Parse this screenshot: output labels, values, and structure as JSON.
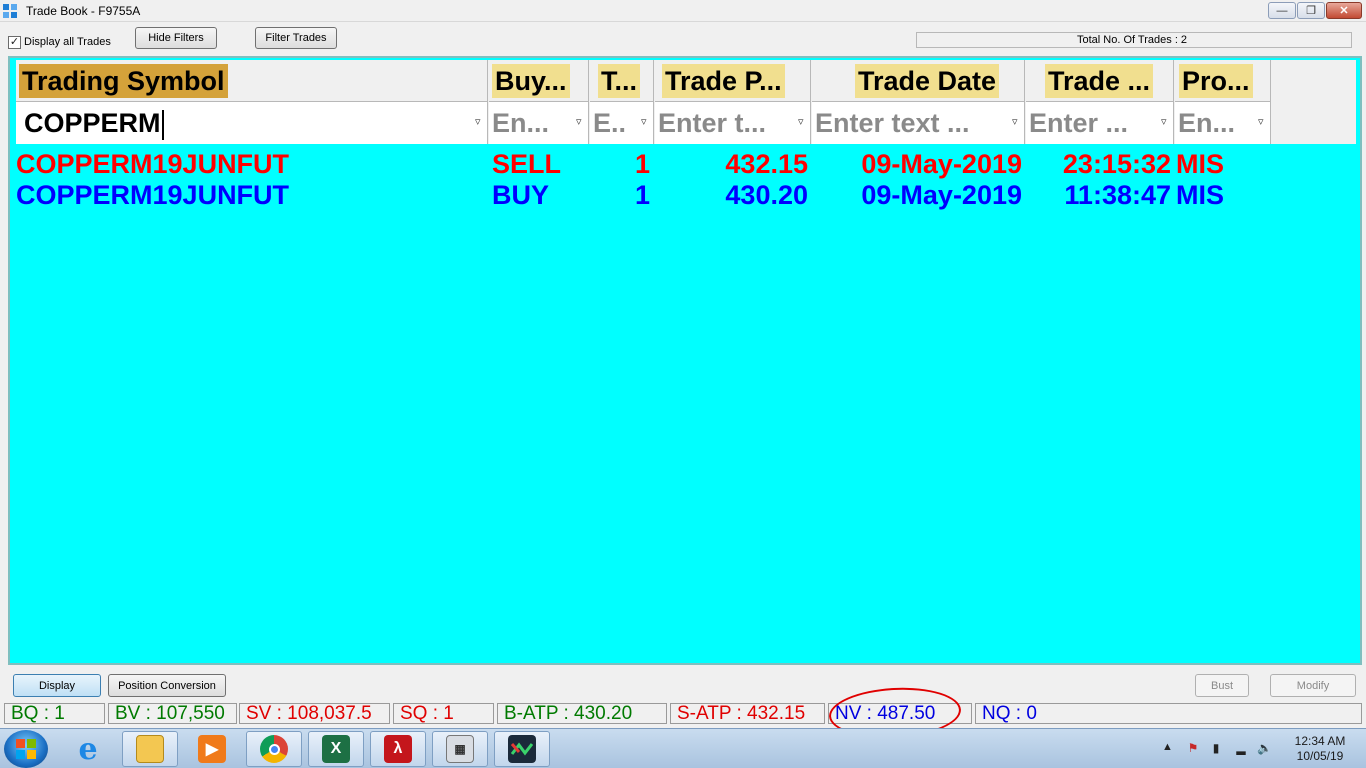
{
  "window": {
    "title": "Trade Book - F9755A"
  },
  "toolbar": {
    "display_all_label": "Display all Trades",
    "display_all_checked": true,
    "hide_filters_label": "Hide Filters",
    "filter_trades_label": "Filter Trades",
    "total_trades": "Total No. Of Trades : 2"
  },
  "grid": {
    "background": "#00ffff",
    "columns": [
      {
        "label": "Trading Symbol",
        "filter_value": "COPPERM",
        "filter_placeholder": ""
      },
      {
        "label": "Buy...",
        "filter_value": "",
        "filter_placeholder": "En..."
      },
      {
        "label": "T...",
        "filter_value": "",
        "filter_placeholder": "E.."
      },
      {
        "label": "Trade P...",
        "filter_value": "",
        "filter_placeholder": "Enter t..."
      },
      {
        "label": "Trade Date",
        "filter_value": "",
        "filter_placeholder": "Enter text ..."
      },
      {
        "label": "Trade ...",
        "filter_value": "",
        "filter_placeholder": "Enter ..."
      },
      {
        "label": "Pro...",
        "filter_value": "",
        "filter_placeholder": "En..."
      }
    ],
    "rows": [
      {
        "color": "#ff0000",
        "cells": [
          "COPPERM19JUNFUT",
          "SELL",
          "1",
          "432.15",
          "09-May-2019",
          "23:15:32",
          "MIS"
        ]
      },
      {
        "color": "#0000ff",
        "cells": [
          "COPPERM19JUNFUT",
          "BUY",
          "1",
          "430.20",
          "09-May-2019",
          "11:38:47",
          "MIS"
        ]
      }
    ]
  },
  "bottom_buttons": {
    "display": "Display",
    "position_conversion": "Position Conversion",
    "bust": "Bust",
    "modify": "Modify"
  },
  "summary": {
    "bq": "BQ : 1",
    "bv": "BV : 107,550",
    "sv": "SV : 108,037.5",
    "sq": "SQ : 1",
    "b_atp": "B-ATP : 430.20",
    "s_atp": "S-ATP : 432.15",
    "nv": "NV : 487.50",
    "nq": "NQ : 0"
  },
  "taskbar": {
    "apps": [
      "internet-explorer",
      "file-explorer",
      "media-player",
      "chrome",
      "excel",
      "acrobat",
      "calculator",
      "trading-app"
    ],
    "time": "12:34 AM",
    "date": "10/05/19"
  }
}
